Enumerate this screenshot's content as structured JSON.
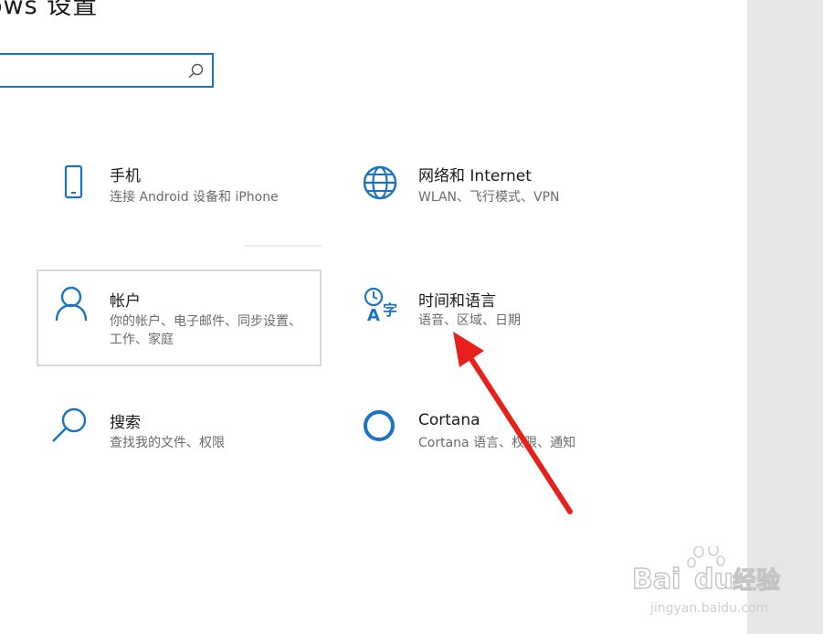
{
  "window": {
    "title": "ows 设置"
  },
  "search": {
    "placeholder": "",
    "value": "",
    "icon": "search-icon"
  },
  "tiles": [
    {
      "name": "手机",
      "desc": "连接 Android 设备和 iPhone",
      "icon": "phone-icon"
    },
    {
      "name": "网络和 Internet",
      "desc": "WLAN、飞行模式、VPN",
      "icon": "globe-icon"
    },
    {
      "name": "帐户",
      "desc": "你的帐户、电子邮件、同步设置、工作、家庭",
      "icon": "person-icon"
    },
    {
      "name": "时间和语言",
      "desc": "语音、区域、日期",
      "icon": "time-language-icon"
    },
    {
      "name": "搜索",
      "desc": "查找我的文件、权限",
      "icon": "magnifier-icon"
    },
    {
      "name": "Cortana",
      "desc": "Cortana 语言、权限、通知",
      "icon": "cortana-ring-icon"
    }
  ],
  "annotation": {
    "color": "#e8201c"
  },
  "colors": {
    "accent": "#1b73c6"
  },
  "watermark": {
    "brand": "Baidu经验",
    "url": "jingyan.baidu.com"
  }
}
